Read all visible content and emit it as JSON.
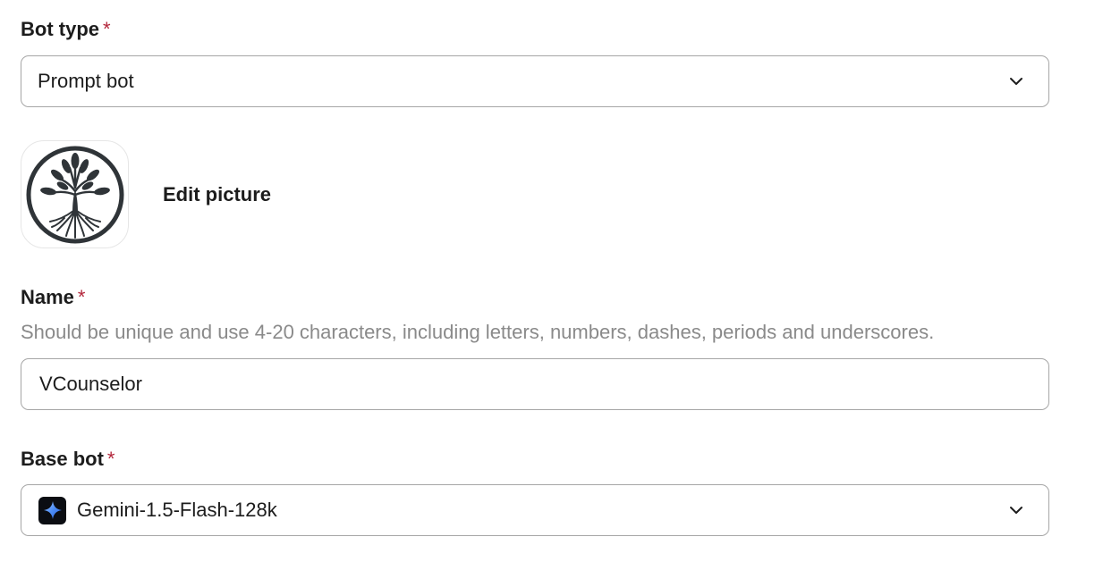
{
  "bot_type": {
    "label": "Bot type",
    "required_mark": "*",
    "selected": "Prompt bot"
  },
  "picture": {
    "avatar_icon": "tree-of-life-icon",
    "edit_label": "Edit picture"
  },
  "name": {
    "label": "Name",
    "required_mark": "*",
    "hint": "Should be unique and use 4-20 characters, including letters, numbers, dashes, periods and underscores.",
    "value": "VCounselor"
  },
  "base_bot": {
    "label": "Base bot",
    "required_mark": "*",
    "selected": "Gemini-1.5-Flash-128k",
    "icon": "gemini-sparkle-icon"
  },
  "colors": {
    "required": "#b3263b",
    "hint": "#8a8a8a",
    "border": "#a6a6a6"
  }
}
